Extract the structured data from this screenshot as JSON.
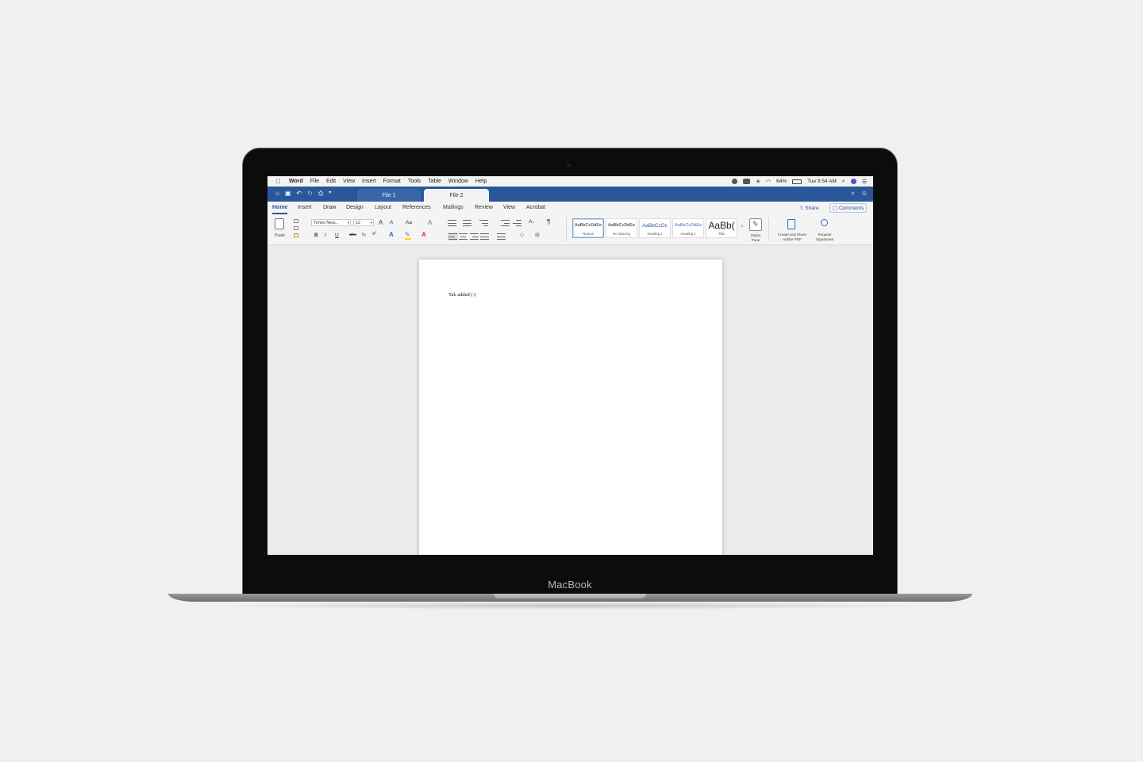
{
  "device": {
    "brand": "MacBook"
  },
  "menubar": {
    "apple_icon": "apple-icon",
    "items": [
      "Word",
      "File",
      "Edit",
      "View",
      "Insert",
      "Format",
      "Tools",
      "Table",
      "Window",
      "Help"
    ],
    "battery": "64%",
    "clock": "Tue 9:54 AM"
  },
  "quick_access": [
    "home-icon",
    "save-icon",
    "undo-icon",
    "redo-icon",
    "print-icon",
    "customize-icon"
  ],
  "doc_tabs": [
    "File 1",
    "File 2"
  ],
  "active_doc_tab": "File 2",
  "ribbon_tabs": [
    "Home",
    "Insert",
    "Draw",
    "Design",
    "Layout",
    "References",
    "Mailings",
    "Review",
    "View",
    "Acrobat"
  ],
  "active_ribbon_tab": "Home",
  "share_label": "Share",
  "comments_label": "Comments",
  "clipboard": {
    "paste_label": "Paste"
  },
  "font": {
    "name": "Times New...",
    "size": "12",
    "grow": "A",
    "shrink": "A",
    "change_case": "Aa",
    "clear_format": "A",
    "bold": "B",
    "italic": "I",
    "underline": "U",
    "strikethrough": "abc",
    "subscript": "x₂",
    "superscript": "x²",
    "text_effects": "A",
    "font_color": "A"
  },
  "paragraph": {
    "show_marks": "¶",
    "sort": "A↓"
  },
  "styles": [
    {
      "preview": "AaBbCcDdEe",
      "name": "Normal"
    },
    {
      "preview": "AaBbCcDdEe",
      "name": "No Spacing"
    },
    {
      "preview": "AaBbCcDc",
      "name": "Heading 1"
    },
    {
      "preview": "AaBbCcDdEe",
      "name": "Heading 2"
    },
    {
      "preview": "AaBb(",
      "name": "Title"
    }
  ],
  "styles_pane": {
    "label_line1": "Styles",
    "label_line2": "Pane"
  },
  "acrobat": {
    "create_line1": "Create and Share",
    "create_line2": "Adobe PDF",
    "request_line1": "Request",
    "request_line2": "Signatures"
  },
  "document": {
    "text": "Tab added (-("
  }
}
